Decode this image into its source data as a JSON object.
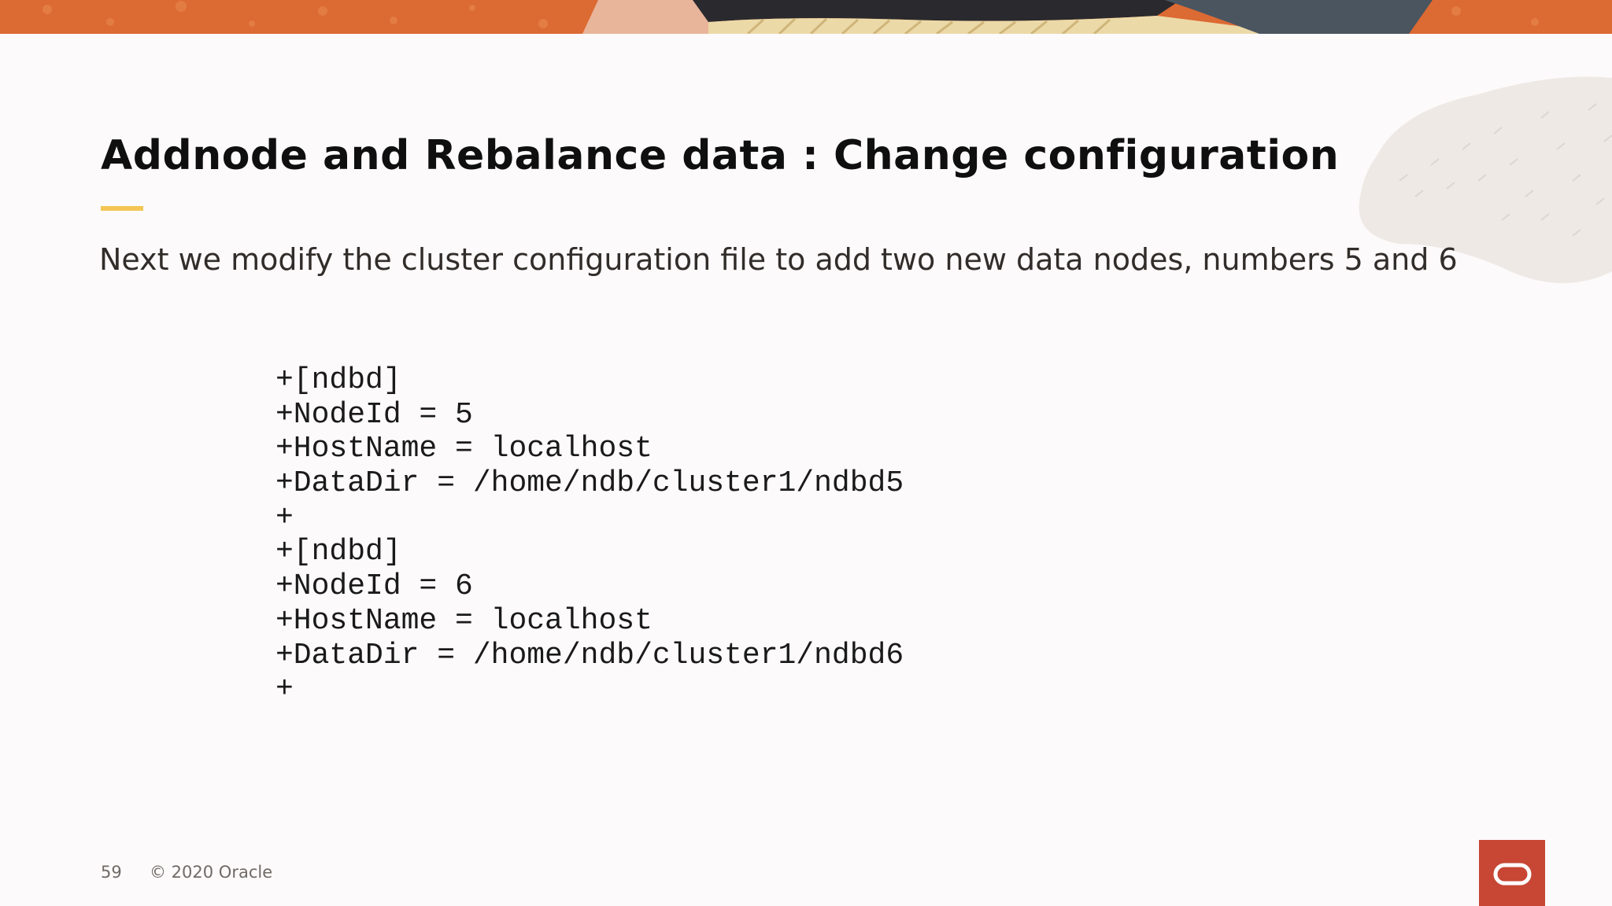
{
  "slide": {
    "title": "Addnode and Rebalance data : Change configuration",
    "subtitle": "Next we modify the cluster configuration file to add two new data nodes, numbers 5 and 6",
    "code_lines": [
      "+[ndbd]",
      "+NodeId = 5",
      "+HostName = localhost",
      "+DataDir = /home/ndb/cluster1/ndbd5",
      "+",
      "+[ndbd]",
      "+NodeId = 6",
      "+HostName = localhost",
      "+DataDir = /home/ndb/cluster1/ndbd6",
      "+"
    ]
  },
  "footer": {
    "page_number": "59",
    "copyright": "© 2020 Oracle"
  },
  "brand": {
    "logo_icon": "oracle-logo-icon",
    "logo_color": "#c74634",
    "accent_underline_color": "#f3c654",
    "banner_color": "#d9642f"
  }
}
